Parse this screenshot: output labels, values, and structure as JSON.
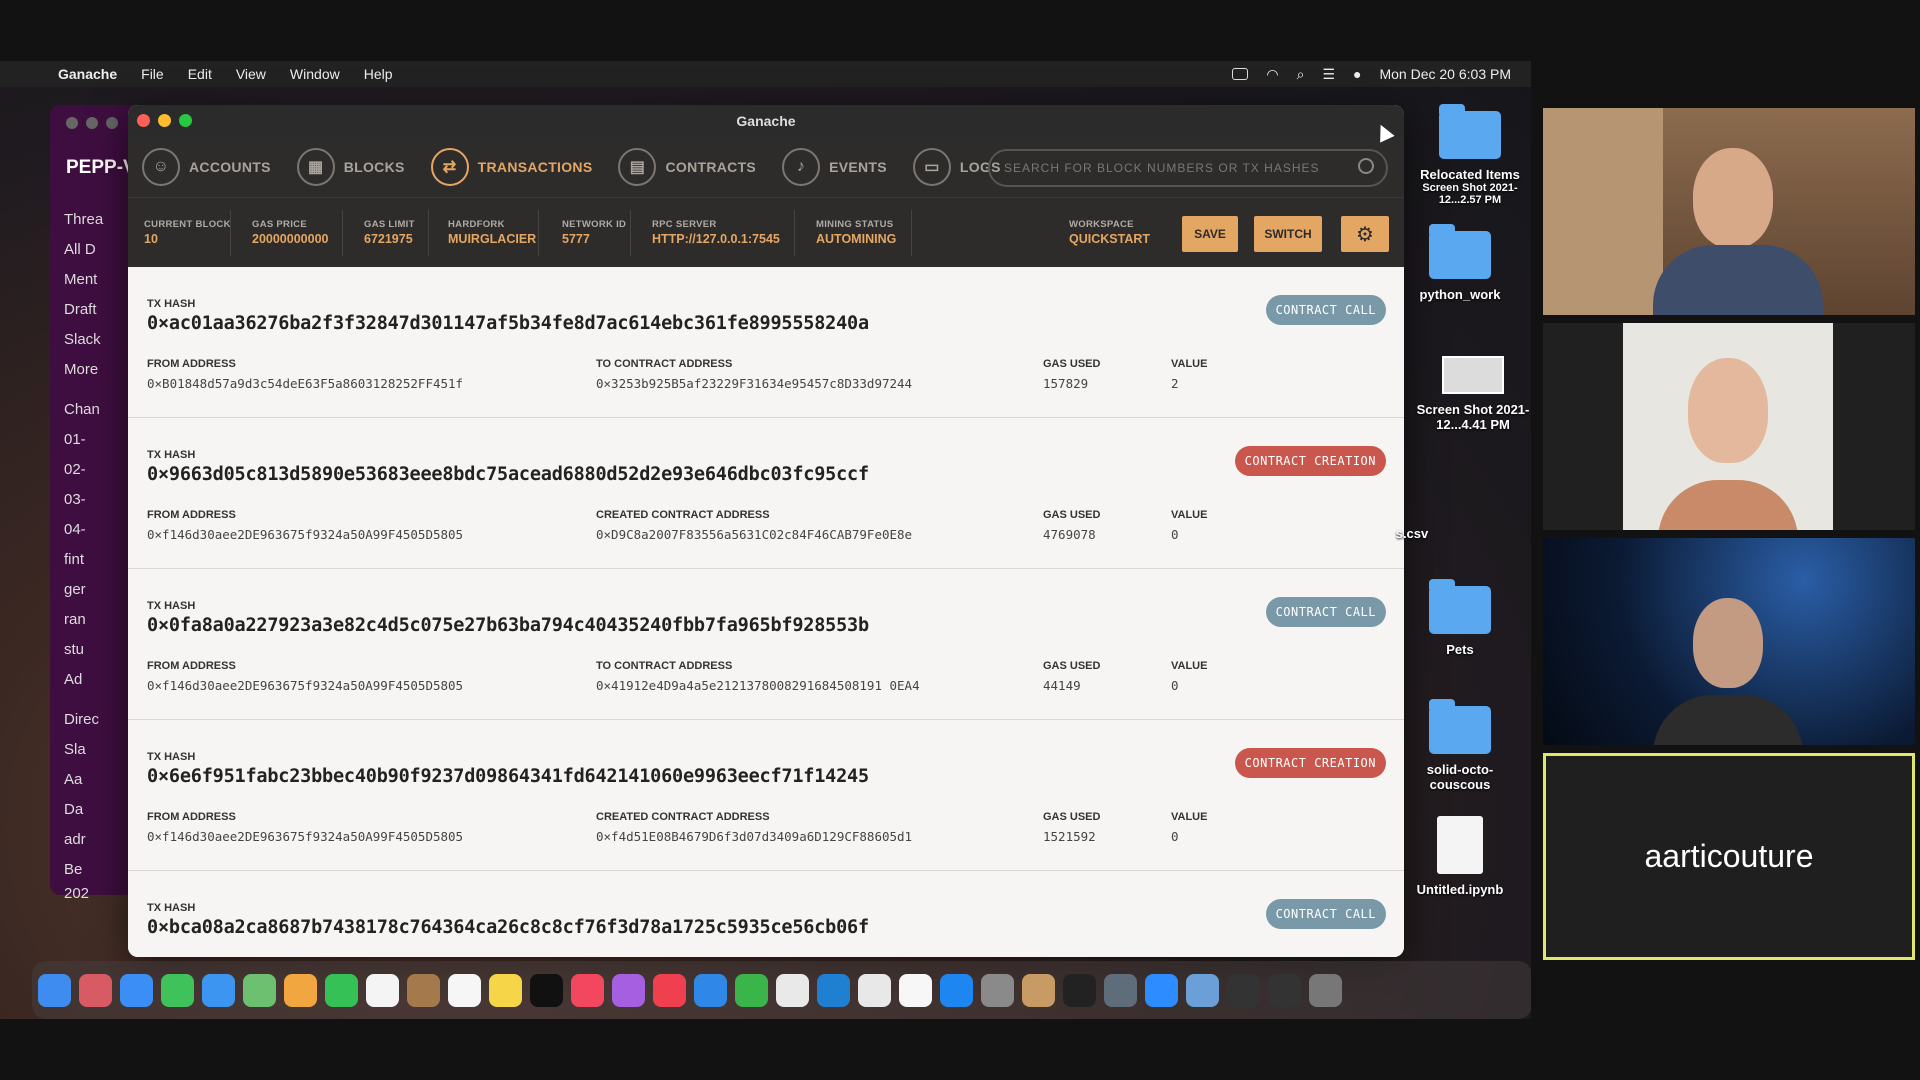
{
  "menubar": {
    "app": "Ganache",
    "items": [
      "File",
      "Edit",
      "View",
      "Window",
      "Help"
    ],
    "clock": "Mon Dec 20  6:03 PM"
  },
  "slack": {
    "workspace": "PEPP-V",
    "items": [
      "Threa",
      "All D",
      "Ment",
      "Draft",
      "Slack",
      "More",
      "Chan",
      "01-",
      "02-",
      "03-",
      "04-",
      "fint",
      "ger",
      "ran",
      "stu",
      "Ad",
      "Direc",
      "Sla",
      "Aa",
      "Da",
      "adr",
      "Be",
      "202"
    ]
  },
  "window": {
    "title": "Ganache"
  },
  "nav": {
    "tabs": [
      {
        "label": "ACCOUNTS",
        "icon": "accounts-icon"
      },
      {
        "label": "BLOCKS",
        "icon": "blocks-icon"
      },
      {
        "label": "TRANSACTIONS",
        "icon": "transactions-icon",
        "active": true
      },
      {
        "label": "CONTRACTS",
        "icon": "contracts-icon"
      },
      {
        "label": "EVENTS",
        "icon": "events-icon"
      },
      {
        "label": "LOGS",
        "icon": "logs-icon"
      }
    ],
    "search_placeholder": "SEARCH FOR BLOCK NUMBERS OR TX HASHES"
  },
  "stats": {
    "current_block": {
      "label": "CURRENT BLOCK",
      "value": "10"
    },
    "gas_price": {
      "label": "GAS PRICE",
      "value": "20000000000"
    },
    "gas_limit": {
      "label": "GAS LIMIT",
      "value": "6721975"
    },
    "hardfork": {
      "label": "HARDFORK",
      "value": "MUIRGLACIER"
    },
    "network_id": {
      "label": "NETWORK ID",
      "value": "5777"
    },
    "rpc_server": {
      "label": "RPC SERVER",
      "value": "HTTP://127.0.0.1:7545"
    },
    "mining_status": {
      "label": "MINING STATUS",
      "value": "AUTOMINING"
    },
    "workspace": {
      "label": "WORKSPACE",
      "value": "QUICKSTART"
    },
    "save_label": "SAVE",
    "switch_label": "SWITCH"
  },
  "labels": {
    "tx_hash": "TX HASH",
    "from_address": "FROM ADDRESS",
    "gas_used": "GAS USED",
    "value": "VALUE"
  },
  "transactions": [
    {
      "hash": "0×ac01aa36276ba2f3f32847d301147af5b34fe8d7ac614ebc361fe8995558240a",
      "type": "CONTRACT CALL",
      "from": "0×B01848d57a9d3c54deE63F5a8603128252FF451f",
      "to_label": "TO CONTRACT ADDRESS",
      "to": "0×3253b925B5af23229F31634e95457c8D33d97244",
      "gas_used": "157829",
      "value": "2"
    },
    {
      "hash": "0×9663d05c813d5890e53683eee8bdc75acead6880d52d2e93e646dbc03fc95ccf",
      "type": "CONTRACT CREATION",
      "from": "0×f146d30aee2DE963675f9324a50A99F4505D5805",
      "to_label": "CREATED CONTRACT ADDRESS",
      "to": "0×D9C8a2007F83556a5631C02c84F46CAB79Fe0E8e",
      "gas_used": "4769078",
      "value": "0"
    },
    {
      "hash": "0×0fa8a0a227923a3e82c4d5c075e27b63ba794c40435240fbb7fa965bf928553b",
      "type": "CONTRACT CALL",
      "from": "0×f146d30aee2DE963675f9324a50A99F4505D5805",
      "to_label": "TO CONTRACT ADDRESS",
      "to": "0×41912e4D9a4a5e2121378008291684508191 0EA4",
      "gas_used": "44149",
      "value": "0"
    },
    {
      "hash": "0×6e6f951fabc23bbec40b90f9237d09864341fd642141060e9963eecf71f14245",
      "type": "CONTRACT CREATION",
      "from": "0×f146d30aee2DE963675f9324a50A99F4505D5805",
      "to_label": "CREATED CONTRACT ADDRESS",
      "to": "0×f4d51E08B4679D6f3d07d3409a6D129CF88605d1",
      "gas_used": "1521592",
      "value": "0"
    },
    {
      "hash": "0×bca08a2ca8687b7438178c764364ca26c8c8cf76f3d78a1725c5935ce56cb06f",
      "type": "CONTRACT CALL",
      "from": "",
      "to_label": "",
      "to": "",
      "gas_used": "",
      "value": ""
    }
  ],
  "desktop": [
    {
      "label": "Relocated Items",
      "kind": "folder"
    },
    {
      "label": "Screen Shot 2021-12...2.57 PM",
      "kind": "shot"
    },
    {
      "label": "python_work",
      "kind": "folder"
    },
    {
      "label": "Screen Shot 2021-12...4.41 PM",
      "kind": "shot"
    },
    {
      "label": "s.csv",
      "kind": "text"
    },
    {
      "label": "Pets",
      "kind": "folder"
    },
    {
      "label": "solid-octo-couscous",
      "kind": "folder"
    },
    {
      "label": "Untitled.ipynb",
      "kind": "doc"
    }
  ],
  "video": {
    "name_tile": "aarticouture"
  },
  "colors": {
    "accent": "#e4a663",
    "call_badge": "#7a99a8",
    "creation_badge": "#c9574d",
    "highlight_border": "#dfe86b"
  }
}
